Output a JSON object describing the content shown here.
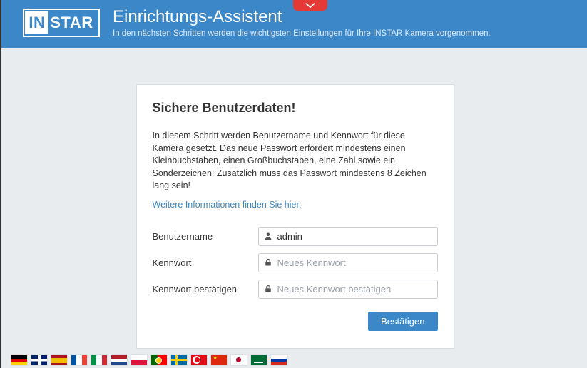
{
  "header": {
    "logo_left": "IN",
    "logo_right": "STAR",
    "title": "Einrichtungs-Assistent",
    "subtitle": "In den nächsten Schritten werden die wichtigsten Einstellungen für Ihre INSTAR Kamera vorgenommen."
  },
  "card": {
    "heading": "Sichere Benutzerdaten!",
    "description": "In diesem Schritt werden Benutzername und Kennwort für diese Kamera gesetzt. Das neue Passwort erfordert mindestens einen Kleinbuchstaben, einen Großbuchstaben, eine Zahl sowie ein Sonderzeichen! Zusätzlich muss das Passwort mindestens 8 Zeichen lang sein!",
    "more_link": "Weitere Informationen finden Sie hier.",
    "fields": {
      "username_label": "Benutzername",
      "username_value": "admin",
      "password_label": "Kennwort",
      "password_placeholder": "Neues Kennwort",
      "confirm_label": "Kennwort bestätigen",
      "confirm_placeholder": "Neues Kennwort bestätigen"
    },
    "confirm_button": "Bestätigen"
  },
  "flags": [
    "de",
    "gb",
    "es",
    "fr",
    "it",
    "nl",
    "pl",
    "pt",
    "se",
    "tr",
    "cn",
    "jp",
    "sa",
    "ru"
  ],
  "colors": {
    "primary": "#3c87c7",
    "accent_red": "#e53935"
  }
}
